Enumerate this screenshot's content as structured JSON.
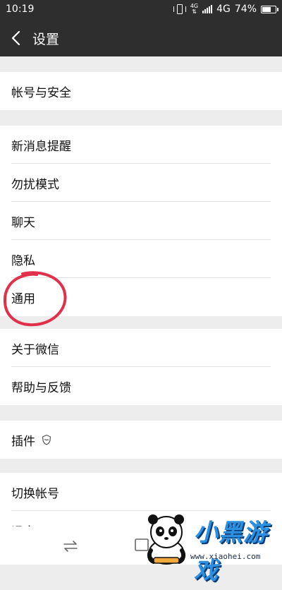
{
  "status_bar": {
    "time": "10:19",
    "net_small_top": "4G",
    "net_small_bottom": "⇅",
    "network": "4G",
    "battery": "74%",
    "battery_level": 0.74
  },
  "header": {
    "title": "设置"
  },
  "sections": {
    "account": {
      "label": "帐号与安全"
    },
    "notifications": {
      "label": "新消息提醒"
    },
    "do_not_disturb": {
      "label": "勿扰模式"
    },
    "chat": {
      "label": "聊天"
    },
    "privacy": {
      "label": "隐私"
    },
    "general": {
      "label": "通用"
    },
    "about": {
      "label": "关于微信"
    },
    "help": {
      "label": "帮助与反馈"
    },
    "plugins": {
      "label": "插件"
    },
    "switch_account": {
      "label": "切换帐号"
    },
    "logout": {
      "label": "退出"
    }
  },
  "watermark": {
    "brand": "小黑游戏",
    "url": "www.xiaohei.com"
  },
  "colors": {
    "header_bg": "#2e2e2e",
    "annotation_circle": "#e0304a",
    "brand_blue": "#2d8fe0"
  }
}
